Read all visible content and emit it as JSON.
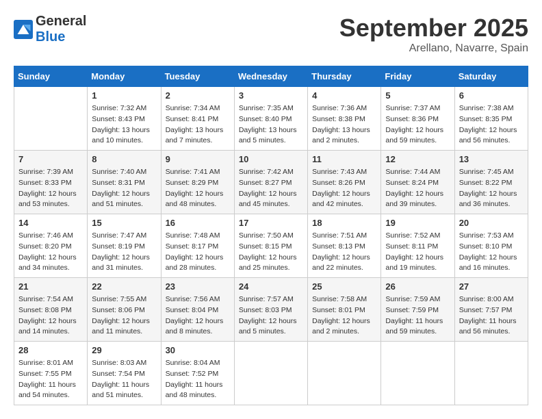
{
  "logo": {
    "line1": "General",
    "line2": "Blue"
  },
  "title": "September 2025",
  "location": "Arellano, Navarre, Spain",
  "days_of_week": [
    "Sunday",
    "Monday",
    "Tuesday",
    "Wednesday",
    "Thursday",
    "Friday",
    "Saturday"
  ],
  "weeks": [
    [
      {
        "day": "",
        "info": ""
      },
      {
        "day": "1",
        "info": "Sunrise: 7:32 AM\nSunset: 8:43 PM\nDaylight: 13 hours\nand 10 minutes."
      },
      {
        "day": "2",
        "info": "Sunrise: 7:34 AM\nSunset: 8:41 PM\nDaylight: 13 hours\nand 7 minutes."
      },
      {
        "day": "3",
        "info": "Sunrise: 7:35 AM\nSunset: 8:40 PM\nDaylight: 13 hours\nand 5 minutes."
      },
      {
        "day": "4",
        "info": "Sunrise: 7:36 AM\nSunset: 8:38 PM\nDaylight: 13 hours\nand 2 minutes."
      },
      {
        "day": "5",
        "info": "Sunrise: 7:37 AM\nSunset: 8:36 PM\nDaylight: 12 hours\nand 59 minutes."
      },
      {
        "day": "6",
        "info": "Sunrise: 7:38 AM\nSunset: 8:35 PM\nDaylight: 12 hours\nand 56 minutes."
      }
    ],
    [
      {
        "day": "7",
        "info": "Sunrise: 7:39 AM\nSunset: 8:33 PM\nDaylight: 12 hours\nand 53 minutes."
      },
      {
        "day": "8",
        "info": "Sunrise: 7:40 AM\nSunset: 8:31 PM\nDaylight: 12 hours\nand 51 minutes."
      },
      {
        "day": "9",
        "info": "Sunrise: 7:41 AM\nSunset: 8:29 PM\nDaylight: 12 hours\nand 48 minutes."
      },
      {
        "day": "10",
        "info": "Sunrise: 7:42 AM\nSunset: 8:27 PM\nDaylight: 12 hours\nand 45 minutes."
      },
      {
        "day": "11",
        "info": "Sunrise: 7:43 AM\nSunset: 8:26 PM\nDaylight: 12 hours\nand 42 minutes."
      },
      {
        "day": "12",
        "info": "Sunrise: 7:44 AM\nSunset: 8:24 PM\nDaylight: 12 hours\nand 39 minutes."
      },
      {
        "day": "13",
        "info": "Sunrise: 7:45 AM\nSunset: 8:22 PM\nDaylight: 12 hours\nand 36 minutes."
      }
    ],
    [
      {
        "day": "14",
        "info": "Sunrise: 7:46 AM\nSunset: 8:20 PM\nDaylight: 12 hours\nand 34 minutes."
      },
      {
        "day": "15",
        "info": "Sunrise: 7:47 AM\nSunset: 8:19 PM\nDaylight: 12 hours\nand 31 minutes."
      },
      {
        "day": "16",
        "info": "Sunrise: 7:48 AM\nSunset: 8:17 PM\nDaylight: 12 hours\nand 28 minutes."
      },
      {
        "day": "17",
        "info": "Sunrise: 7:50 AM\nSunset: 8:15 PM\nDaylight: 12 hours\nand 25 minutes."
      },
      {
        "day": "18",
        "info": "Sunrise: 7:51 AM\nSunset: 8:13 PM\nDaylight: 12 hours\nand 22 minutes."
      },
      {
        "day": "19",
        "info": "Sunrise: 7:52 AM\nSunset: 8:11 PM\nDaylight: 12 hours\nand 19 minutes."
      },
      {
        "day": "20",
        "info": "Sunrise: 7:53 AM\nSunset: 8:10 PM\nDaylight: 12 hours\nand 16 minutes."
      }
    ],
    [
      {
        "day": "21",
        "info": "Sunrise: 7:54 AM\nSunset: 8:08 PM\nDaylight: 12 hours\nand 14 minutes."
      },
      {
        "day": "22",
        "info": "Sunrise: 7:55 AM\nSunset: 8:06 PM\nDaylight: 12 hours\nand 11 minutes."
      },
      {
        "day": "23",
        "info": "Sunrise: 7:56 AM\nSunset: 8:04 PM\nDaylight: 12 hours\nand 8 minutes."
      },
      {
        "day": "24",
        "info": "Sunrise: 7:57 AM\nSunset: 8:03 PM\nDaylight: 12 hours\nand 5 minutes."
      },
      {
        "day": "25",
        "info": "Sunrise: 7:58 AM\nSunset: 8:01 PM\nDaylight: 12 hours\nand 2 minutes."
      },
      {
        "day": "26",
        "info": "Sunrise: 7:59 AM\nSunset: 7:59 PM\nDaylight: 11 hours\nand 59 minutes."
      },
      {
        "day": "27",
        "info": "Sunrise: 8:00 AM\nSunset: 7:57 PM\nDaylight: 11 hours\nand 56 minutes."
      }
    ],
    [
      {
        "day": "28",
        "info": "Sunrise: 8:01 AM\nSunset: 7:55 PM\nDaylight: 11 hours\nand 54 minutes."
      },
      {
        "day": "29",
        "info": "Sunrise: 8:03 AM\nSunset: 7:54 PM\nDaylight: 11 hours\nand 51 minutes."
      },
      {
        "day": "30",
        "info": "Sunrise: 8:04 AM\nSunset: 7:52 PM\nDaylight: 11 hours\nand 48 minutes."
      },
      {
        "day": "",
        "info": ""
      },
      {
        "day": "",
        "info": ""
      },
      {
        "day": "",
        "info": ""
      },
      {
        "day": "",
        "info": ""
      }
    ]
  ]
}
